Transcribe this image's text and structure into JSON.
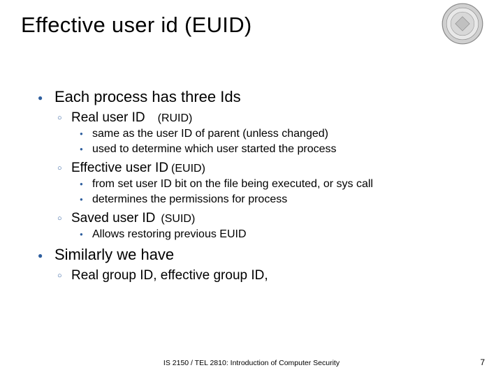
{
  "title": "Effective user id (EUID)",
  "bullets": {
    "b1": "Each process has three Ids",
    "b1_1": "Real user ID",
    "b1_1_paren": "(RUID)",
    "b1_1_1": "same as the user ID of parent (unless changed)",
    "b1_1_2": "used to determine which user started the process",
    "b1_2": "Effective user ID",
    "b1_2_paren": "(EUID)",
    "b1_2_1": "from set user ID bit on the file being executed, or sys call",
    "b1_2_2": "determines the permissions for process",
    "b1_3": "Saved user ID",
    "b1_3_paren": "(SUID)",
    "b1_3_1": "Allows restoring previous EUID",
    "b2": "Similarly we have",
    "b2_1": "Real group ID, effective group ID,"
  },
  "footer": "IS 2150 / TEL 2810: Introduction of Computer Security",
  "page": "7"
}
